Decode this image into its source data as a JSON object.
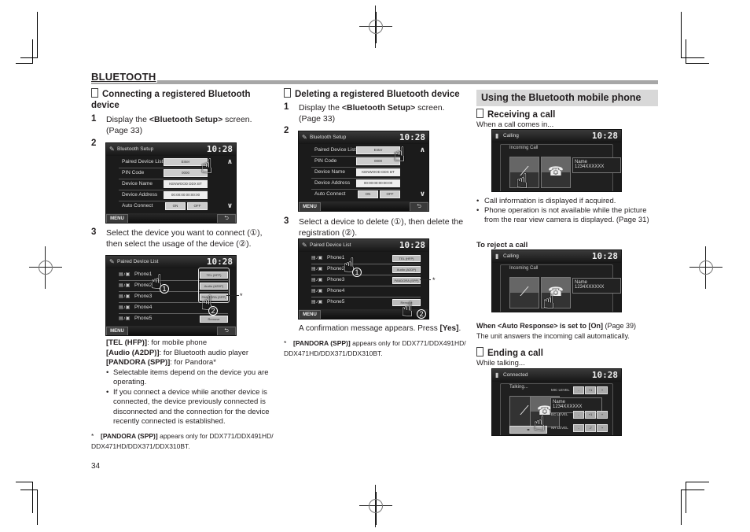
{
  "page": {
    "section_title": "BLUETOOTH",
    "page_number": "34"
  },
  "col1": {
    "heading": "Connecting a registered Bluetooth device",
    "step1_num": "1",
    "step1_pre": "Display the ",
    "step1_bold": "<Bluetooth Setup>",
    "step1_post": " screen. (Page 33)",
    "step2_num": "2",
    "step3_num": "3",
    "step3_text": "Select the device you want to connect (①), then select the usage of the device (②).",
    "usage": [
      {
        "bold": "[TEL (HFP)]",
        "text": ": for mobile phone"
      },
      {
        "bold": "[Audio (A2DP)]",
        "text": ": for Bluetooth audio player"
      },
      {
        "bold": "[PANDORA (SPP)]",
        "text": ": for Pandora*"
      }
    ],
    "bullets": [
      "Selectable items depend on the device you are operating.",
      "If you connect a device while another device is connected, the device previously connected is disconnected and the connection for the device recently connected is established."
    ],
    "footnote_mark": "*",
    "footnote_bold": "[PANDORA (SPP)]",
    "footnote_text": " appears only for DDX771/DDX491HD/ DDX471HD/DDX371/DDX310BT."
  },
  "col2": {
    "heading": "Deleting a registered Bluetooth device",
    "step1_num": "1",
    "step1_pre": "Display the ",
    "step1_bold": "<Bluetooth Setup>",
    "step1_post": " screen. (Page 33)",
    "step2_num": "2",
    "step3_num": "3",
    "step3_text": "Select a device to delete (①), then delete the registration (②).",
    "confirm_pre": "A confirmation message appears. Press ",
    "confirm_bold": "[Yes]",
    "confirm_post": ".",
    "footnote_mark": "*",
    "footnote_bold": "[PANDORA (SPP)]",
    "footnote_text": " appears only for DDX771/DDX491HD/ DDX471HD/DDX371/DDX310BT."
  },
  "col3": {
    "heading": "Using the Bluetooth mobile phone",
    "receiving_heading": "Receiving a call",
    "receiving_intro": "When a call comes in...",
    "bullets": [
      "Call information is displayed if acquired.",
      "Phone operation is not available while the picture from the rear view camera is displayed. (Page 31)"
    ],
    "reject_heading": "To reject a call",
    "auto_bold": "When <Auto Response> is set to [On]",
    "auto_page": " (Page 39)",
    "auto_text": "The unit answers the incoming call automatically.",
    "ending_heading": "Ending a call",
    "ending_intro": "While talking..."
  },
  "screens": {
    "clock": "10:28",
    "bt_setup": {
      "title": "Bluetooth Setup",
      "rows": [
        {
          "label": "Paired Device List",
          "value": "Enter"
        },
        {
          "label": "PIN Code",
          "value": "0000"
        },
        {
          "label": "Device Name",
          "value": "KENWOOD DDX BT"
        },
        {
          "label": "Device Address",
          "value": "00:00:00:00:00:00"
        },
        {
          "label": "Auto Connect",
          "on": "ON",
          "off": "OFF"
        }
      ],
      "menu": "MENU",
      "back": "⮌"
    },
    "paired_list": {
      "title": "Paired Device List",
      "phones": [
        "Phone1",
        "Phone2",
        "Phone3",
        "Phone4",
        "Phone5"
      ],
      "buttons": [
        "TEL (HFP)",
        "Audio (A2DP)",
        "PANDORA (SPP)",
        "",
        "Remove"
      ],
      "menu": "MENU"
    },
    "calling": {
      "title": "Calling",
      "status": "Incoming Call",
      "name": "Name",
      "number": "1234XXXXXX"
    },
    "connected": {
      "title": "Connected",
      "status": "Talking...",
      "name": "Name",
      "number": "1234XXXXXX",
      "levels": [
        {
          "label": "MIC LEVEL",
          "value": "+1"
        },
        {
          "label": "EC LEVEL",
          "value": "+1"
        },
        {
          "label": "NR LEVEL",
          "value": "-7"
        }
      ]
    }
  }
}
